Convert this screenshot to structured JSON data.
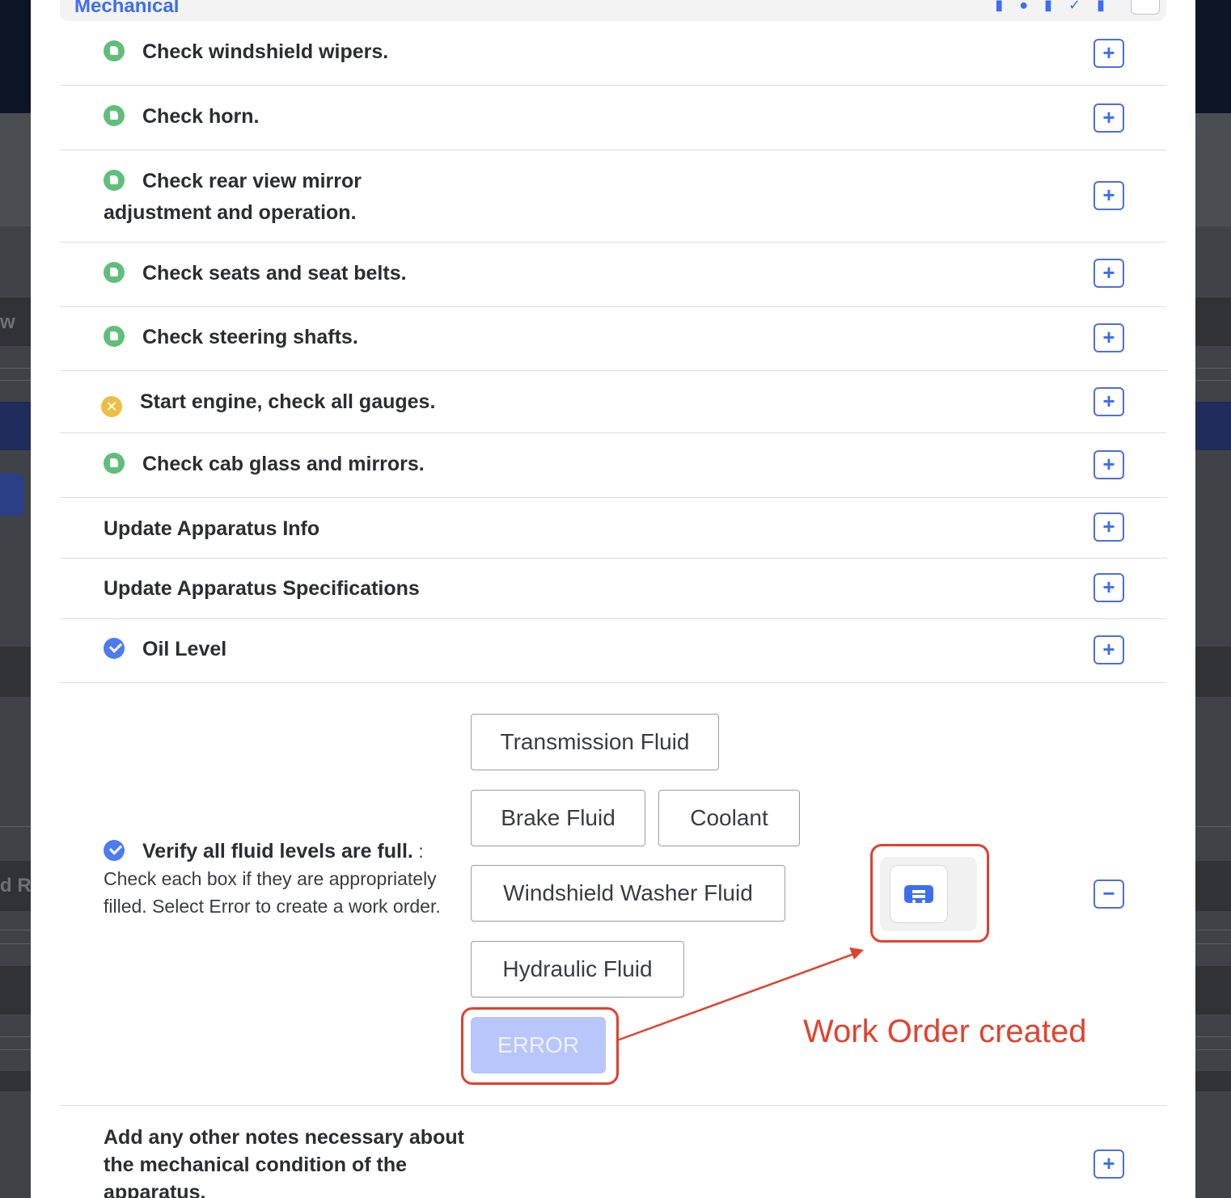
{
  "section": {
    "title": "Mechanical"
  },
  "background": {
    "fragment_left_1": "w",
    "fragment_left_2": "d R"
  },
  "items": [
    {
      "label": "Check windshield wipers.",
      "status": "ok"
    },
    {
      "label": "Check horn.",
      "status": "ok"
    },
    {
      "label": "Check rear view mirror",
      "label_cont": "adjustment and operation.",
      "status": "ok"
    },
    {
      "label": "Check seats and seat belts.",
      "status": "ok"
    },
    {
      "label": "Check steering shafts.",
      "status": "ok"
    },
    {
      "label": "Start engine, check all gauges.",
      "status": "fail"
    },
    {
      "label": "Check cab glass and mirrors.",
      "status": "ok"
    },
    {
      "label": "Update Apparatus Info"
    },
    {
      "label": "Update Apparatus Specifications"
    },
    {
      "label": "Oil Level",
      "status": "checked"
    }
  ],
  "fluid": {
    "title": "Verify all fluid levels are full.",
    "sep": " :",
    "description": "Check each box if they are appropriately filled. Select Error to create a work order.",
    "options": [
      "Transmission Fluid",
      "Brake Fluid",
      "Coolant",
      "Windshield Washer Fluid",
      "Hydraulic Fluid"
    ],
    "error_label": "ERROR"
  },
  "annotation": "Work Order created",
  "notes_item": {
    "label": "Add any other notes necessary about the mechanical condition of the apparatus."
  },
  "colors": {
    "accent": "#3d6ef0",
    "ok": "#5fbf7a",
    "warn": "#edbd45",
    "annotation": "#e04330"
  }
}
